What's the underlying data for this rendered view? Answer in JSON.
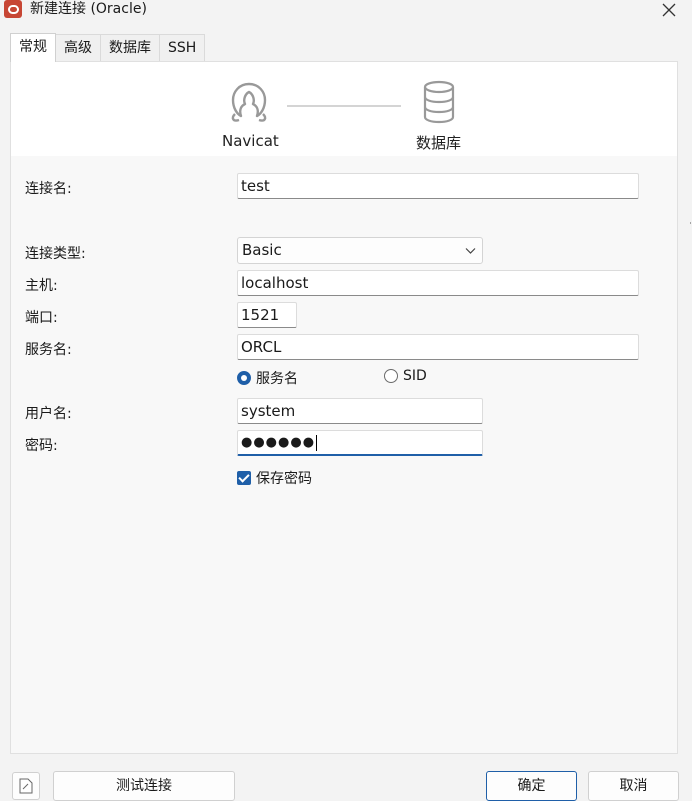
{
  "window": {
    "title": "新建连接 (Oracle)"
  },
  "tabs": [
    {
      "label": "常规",
      "active": true
    },
    {
      "label": "高级",
      "active": false
    },
    {
      "label": "数据库",
      "active": false
    },
    {
      "label": "SSH",
      "active": false
    }
  ],
  "header": {
    "step1_label": "Navicat",
    "step2_label": "数据库"
  },
  "form": {
    "connection_name": {
      "label": "连接名:",
      "value": "test"
    },
    "connection_type": {
      "label": "连接类型:",
      "value": "Basic"
    },
    "host": {
      "label": "主机:",
      "value": "localhost"
    },
    "port": {
      "label": "端口:",
      "value": "1521"
    },
    "service_name": {
      "label": "服务名:",
      "value": "ORCL"
    },
    "service_type": {
      "options": [
        "服务名",
        "SID"
      ],
      "selected": "服务名"
    },
    "username": {
      "label": "用户名:",
      "value": "system"
    },
    "password": {
      "label": "密码:",
      "value": "●●●●●●"
    },
    "save_password": {
      "label": "保存密码",
      "checked": true
    }
  },
  "buttons": {
    "test_connection": "测试连接",
    "ok": "确定",
    "cancel": "取消"
  },
  "colors": {
    "accent": "#1f5fa8",
    "oracle_red": "#c74634"
  },
  "icons": [
    "oracle-app-icon",
    "close-icon",
    "navicat-icon",
    "database-icon",
    "chevron-down-icon",
    "notes-icon"
  ]
}
